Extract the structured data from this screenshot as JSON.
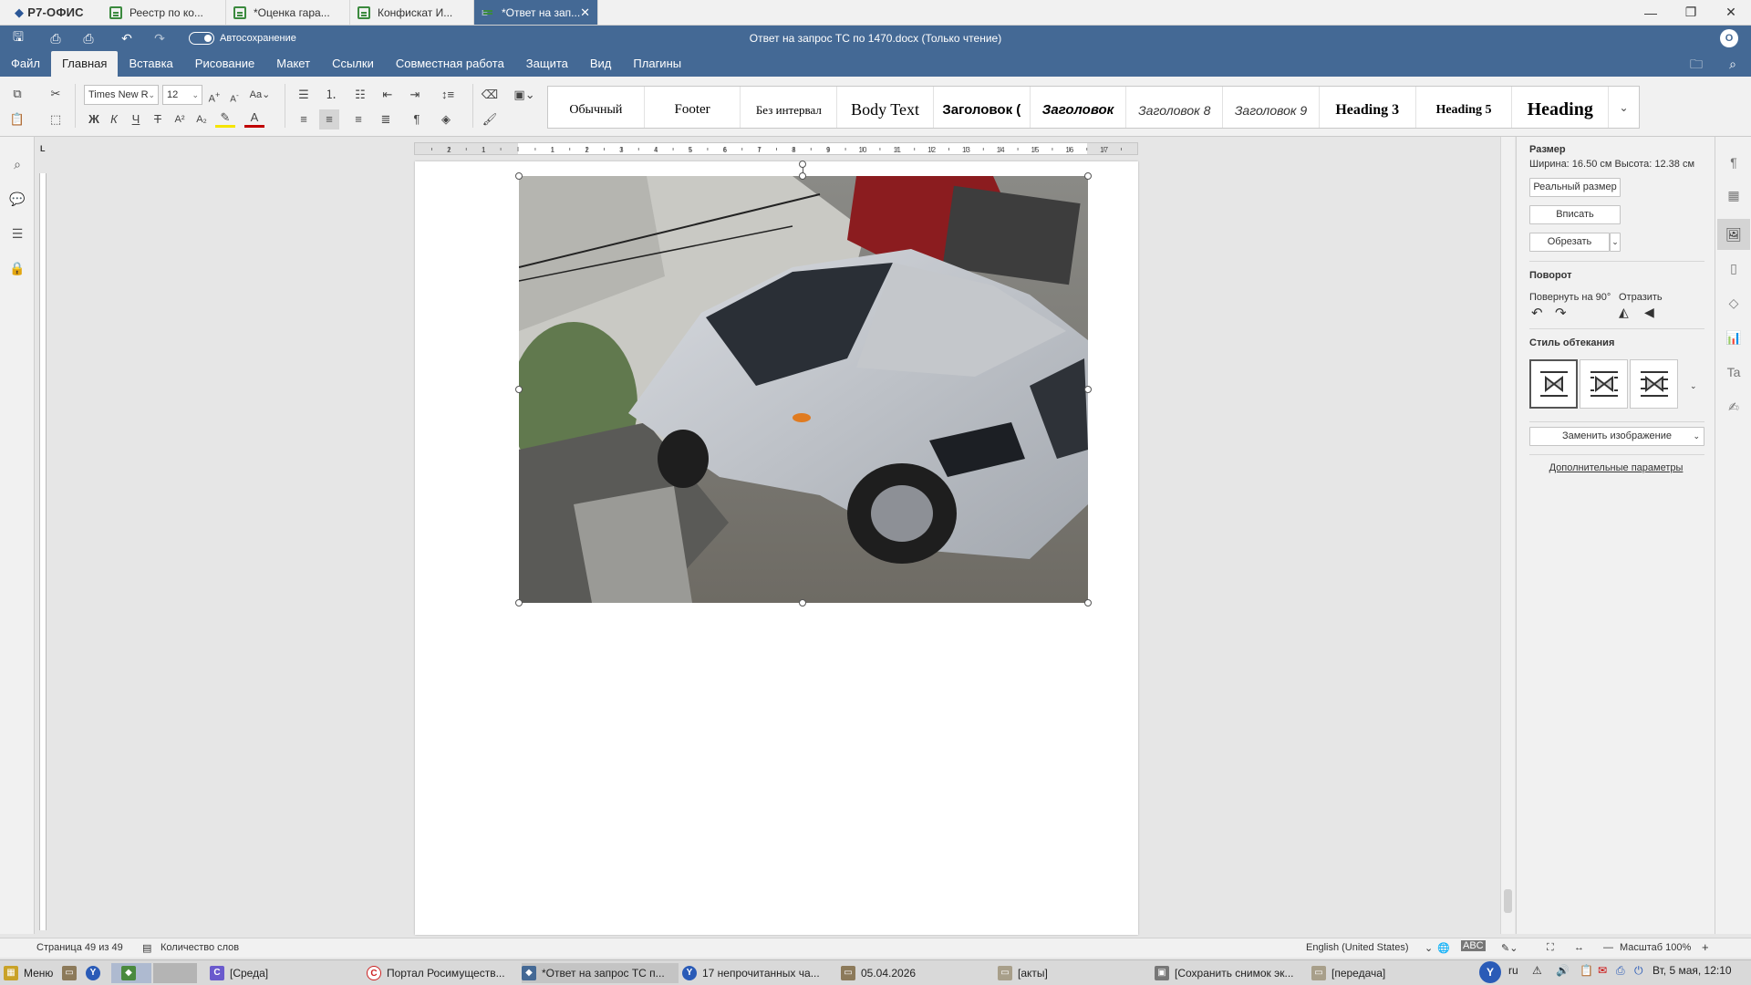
{
  "app": {
    "name": "Р7-ОФИС"
  },
  "tabs": [
    {
      "label": "Реестр по ко...",
      "active": false
    },
    {
      "label": "*Оценка гара...",
      "active": false
    },
    {
      "label": "Конфискат И...",
      "active": false
    },
    {
      "label": "*Ответ на зап...",
      "active": true
    }
  ],
  "title": {
    "autosave_label": "Автосохранение",
    "document": "Ответ на запрос ТС по 1470.docx (Только чтение)",
    "avatar": "O"
  },
  "menu": [
    "Файл",
    "Главная",
    "Вставка",
    "Рисование",
    "Макет",
    "Ссылки",
    "Совместная работа",
    "Защита",
    "Вид",
    "Плагины"
  ],
  "menu_active": "Главная",
  "toolbar": {
    "font_name": "Times New R",
    "font_size": "12",
    "styles": [
      {
        "label": "Обычный"
      },
      {
        "label": "Footer"
      },
      {
        "label": "Без интервал"
      },
      {
        "label": "Body Text"
      },
      {
        "label": "Заголовок ("
      },
      {
        "label": "Заголовок"
      },
      {
        "label": "Заголовок 8"
      },
      {
        "label": "Заголовок 9"
      },
      {
        "label": "Heading 3"
      },
      {
        "label": "Heading 5"
      },
      {
        "label": "Heading"
      }
    ]
  },
  "ruler": {
    "h_numbers": [
      "2",
      "1",
      "1",
      "2",
      "3",
      "4",
      "5",
      "6",
      "7",
      "8",
      "9",
      "10",
      "11",
      "12",
      "13",
      "14",
      "15",
      "16",
      "17"
    ]
  },
  "panel": {
    "size_title": "Размер",
    "size_text": "Ширина: 16.50 см   Высота: 12.38 см",
    "btn_real_size": "Реальный размер",
    "btn_fit": "Вписать",
    "btn_crop": "Обрезать",
    "rotation_title": "Поворот",
    "rotate_label": "Повернуть на 90°",
    "flip_label": "Отразить",
    "wrap_title": "Стиль обтекания",
    "replace_label": "Заменить изображение",
    "advanced_label": "Дополнительные параметры"
  },
  "status": {
    "page": "Страница 49 из 49",
    "word_count": "Количество слов",
    "language": "English (United States)",
    "zoom": "Масштаб 100%"
  },
  "taskbar": {
    "start": "Меню",
    "items": [
      {
        "label": "[Среда]",
        "active": false
      },
      {
        "label": "Портал Росимуществ...",
        "active": false
      },
      {
        "label": "*Ответ на запрос ТС п...",
        "active": true
      },
      {
        "label": "17 непрочитанных ча...",
        "active": false
      },
      {
        "label": "05.04.2026",
        "active": false
      },
      {
        "label": "[акты]",
        "active": false
      },
      {
        "label": "[Сохранить снимок эк...",
        "active": false
      },
      {
        "label": "[передача]",
        "active": false
      }
    ],
    "lang": "ru",
    "clock": "Вт, 5 мая, 12:10"
  },
  "colors": {
    "accent": "#446995",
    "sheet_icon": "#3b8a3e"
  }
}
